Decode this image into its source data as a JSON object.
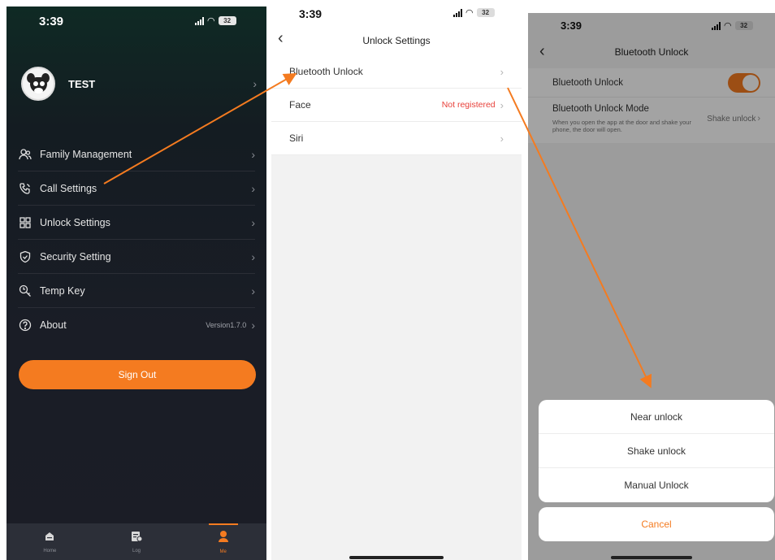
{
  "colors": {
    "accent": "#f47b20",
    "danger": "#e8403a",
    "dark_bg": "#1b1d26"
  },
  "panel1": {
    "time": "3:39",
    "battery": "32",
    "username": "TEST",
    "menu": [
      {
        "label": "Family Management",
        "icon": "family-icon"
      },
      {
        "label": "Call Settings",
        "icon": "phone-icon"
      },
      {
        "label": "Unlock  Settings",
        "icon": "grid-icon"
      },
      {
        "label": "Security Setting",
        "icon": "shield-icon"
      },
      {
        "label": "Temp Key",
        "icon": "temp-key-icon"
      },
      {
        "label": "About",
        "icon": "question-icon",
        "value": "Version1.7.0"
      }
    ],
    "sign_out": "Sign Out",
    "tabs": [
      {
        "label": "Home",
        "icon": "home-icon"
      },
      {
        "label": "Log",
        "icon": "log-icon"
      },
      {
        "label": "Me",
        "icon": "me-icon",
        "active": true
      }
    ]
  },
  "panel2": {
    "time": "3:39",
    "battery": "32",
    "title": "Unlock  Settings",
    "rows": [
      {
        "label": "Bluetooth Unlock",
        "value": ""
      },
      {
        "label": "Face",
        "value": "Not registered"
      },
      {
        "label": "Siri",
        "value": ""
      }
    ]
  },
  "panel3": {
    "time": "3:39",
    "battery": "32",
    "title": "Bluetooth Unlock",
    "toggle_label": "Bluetooth Unlock",
    "toggle_on": true,
    "mode_label": "Bluetooth Unlock Mode",
    "mode_desc": "When you open the app at the door and shake your phone, the door will open.",
    "mode_value": "Shake unlock",
    "sheet_options": [
      "Near unlock",
      "Shake unlock",
      "Manual Unlock"
    ],
    "cancel": "Cancel"
  }
}
